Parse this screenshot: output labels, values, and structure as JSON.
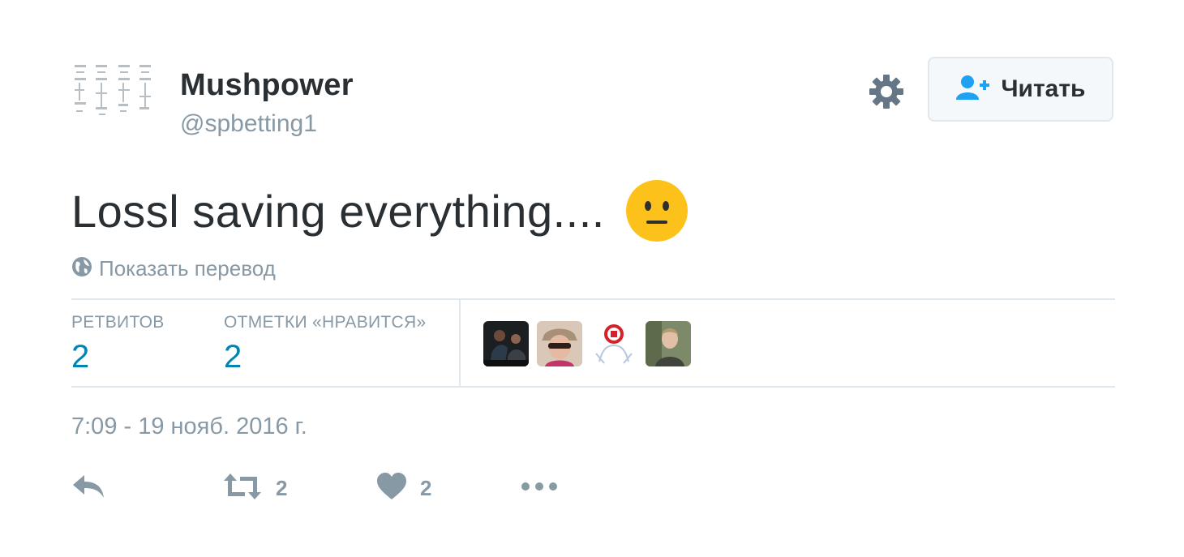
{
  "user": {
    "display_name": "Mushpower",
    "handle": "@spbetting1"
  },
  "follow_button": {
    "label": "Читать"
  },
  "tweet": {
    "text": "Lossl saving everything....",
    "emoji": "neutral-face-emoji"
  },
  "translate": {
    "label": "Показать перевод"
  },
  "stats": {
    "retweets_label": "РЕТВИТОВ",
    "retweets_count": "2",
    "likes_label": "ОТМЕТКИ «НРАВИТСЯ»",
    "likes_count": "2"
  },
  "timestamp": "7:09 - 19 нояб. 2016 г.",
  "actions": {
    "reply_icon": "reply-icon",
    "retweet_count": "2",
    "like_count": "2",
    "more_icon": "more-icon"
  },
  "colors": {
    "link_blue": "#0084b4",
    "muted_gray": "#8899a6",
    "text_dark": "#292f33",
    "follow_icon": "#1da1f2",
    "emoji_yellow": "#fcc21b"
  }
}
